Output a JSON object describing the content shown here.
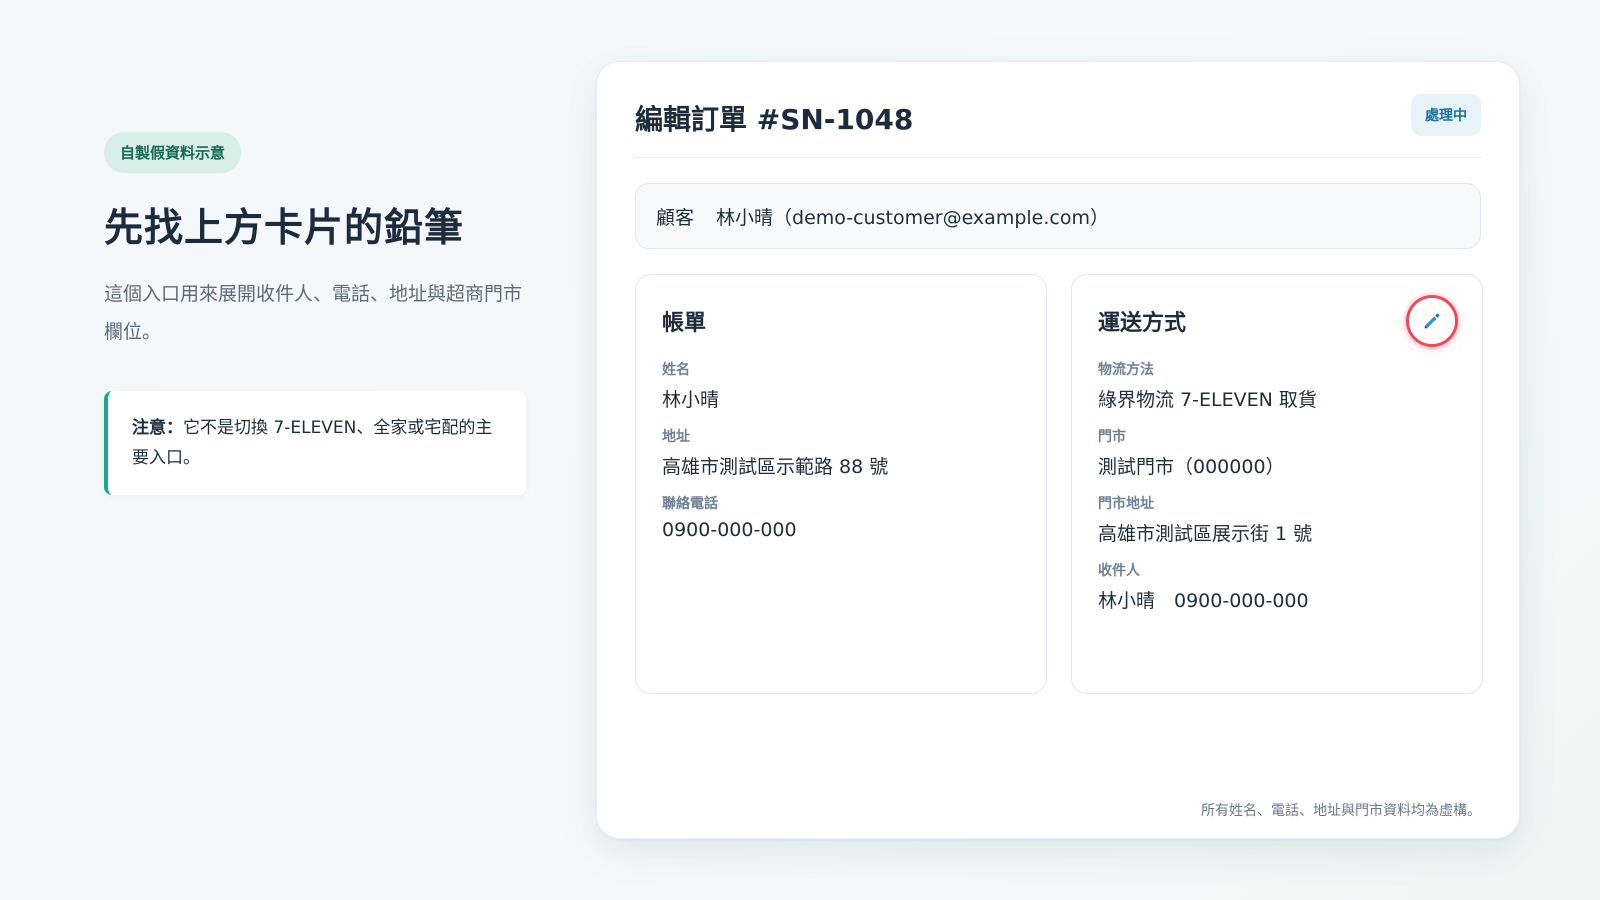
{
  "intro": {
    "tag": "自製假資料示意",
    "headline": "先找上方卡片的鉛筆",
    "description": "這個入口用來展開收件人、電話、地址與超商門市欄位。",
    "note_strong": "注意：",
    "note_text": "它不是切換 7-ELEVEN、全家或宅配的主要入口。"
  },
  "order": {
    "title": "編輯訂單 #SN-1048",
    "status": "處理中",
    "customer_label": "顧客",
    "customer_value": "林小晴（demo-customer@example.com）"
  },
  "billing": {
    "title": "帳單",
    "fields": [
      {
        "label": "姓名",
        "value": "林小晴"
      },
      {
        "label": "地址",
        "value": "高雄市測試區示範路 88 號"
      },
      {
        "label": "聯絡電話",
        "value": "0900-000-000"
      }
    ]
  },
  "shipping": {
    "title": "運送方式",
    "edit_icon": "pencil-icon",
    "fields": [
      {
        "label": "物流方法",
        "value": "綠界物流 7-ELEVEN 取貨"
      },
      {
        "label": "門市",
        "value": "測試門市（000000）"
      },
      {
        "label": "門市地址",
        "value": "高雄市測試區展示街 1 號"
      },
      {
        "label": "收件人",
        "value": "林小晴　0900-000-000"
      }
    ]
  },
  "footer": "所有姓名、電話、地址與門市資料均為虛構。",
  "colors": {
    "accent_teal": "#1aa58e",
    "edit_ring": "#ec4a5c",
    "status_text": "#1870a3"
  }
}
